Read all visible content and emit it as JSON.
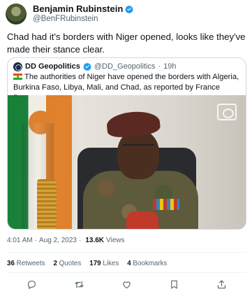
{
  "author": {
    "display_name": "Benjamin Rubinstein",
    "handle": "@BenFRubinstein",
    "avatar_icon": "avatar-image",
    "verified_color": "#1d9bf0"
  },
  "tweet": {
    "text": "Chad had it's borders with Niger opened, looks like they've made their stance clear."
  },
  "quote": {
    "display_name": "DD Geopolitics",
    "handle": "@DD_Geopolitics",
    "separator": "·",
    "time": "19h",
    "flag_icon": "niger-flag-icon",
    "text": "The authorities of Niger have opened the borders with Algeria, Burkina Faso, Libya, Mali, and Chad, as reported by France Press."
  },
  "meta": {
    "time": "4:01 AM",
    "date": "Aug 2, 2023",
    "separator": "·",
    "views_count": "13.6K",
    "views_label": "Views"
  },
  "stats": {
    "retweets_count": "36",
    "retweets_label": "Retweets",
    "quotes_count": "2",
    "quotes_label": "Quotes",
    "likes_count": "179",
    "likes_label": "Likes",
    "bookmarks_count": "4",
    "bookmarks_label": "Bookmarks"
  },
  "actions": [
    "reply-icon",
    "retweet-icon",
    "like-icon",
    "bookmark-icon",
    "share-icon"
  ]
}
